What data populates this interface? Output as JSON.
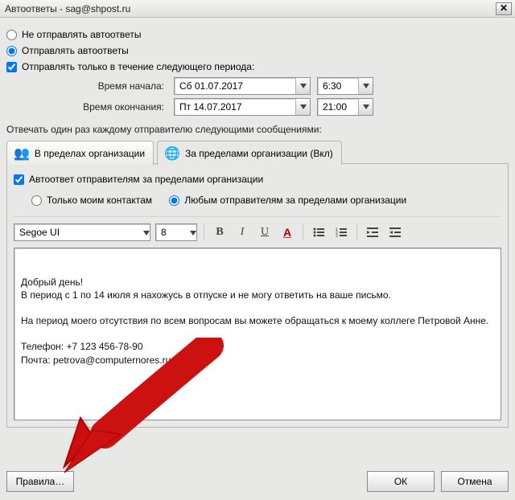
{
  "window": {
    "title": "Автоответы - sag@shpost.ru"
  },
  "radios": {
    "no_send": "Не отправлять автоответы",
    "send": "Отправлять автоответы"
  },
  "period": {
    "checkbox": "Отправлять только в течение следующего периода:",
    "start_label": "Время начала:",
    "end_label": "Время окончания:",
    "start_date": "Сб 01.07.2017",
    "start_time": "6:30",
    "end_date": "Пт 14.07.2017",
    "end_time": "21:00"
  },
  "section_label": "Отвечать один раз каждому отправителю следующими сообщениями:",
  "tabs": {
    "inside": "В пределах организации",
    "outside": "За пределами организации (Вкл)"
  },
  "outside": {
    "checkbox": "Автоответ отправителям за пределами организации",
    "only_contacts": "Только моим контактам",
    "any_senders": "Любым отправителям за пределами организации"
  },
  "editor": {
    "font": "Segoe UI",
    "size": "8",
    "body": "Добрый день!\nВ период с 1 по 14 июля я нахожусь в отпуске и не могу ответить на ваше письмо.\n\nНа период моего отсутствия по всем вопросам вы можете обращаться к моему коллеге Петровой Анне.\n\nТелефон: +7 123 456-78-90\nПочта: petrova@computernores.ru"
  },
  "buttons": {
    "rules": "Правила…",
    "ok": "ОК",
    "cancel": "Отмена"
  }
}
